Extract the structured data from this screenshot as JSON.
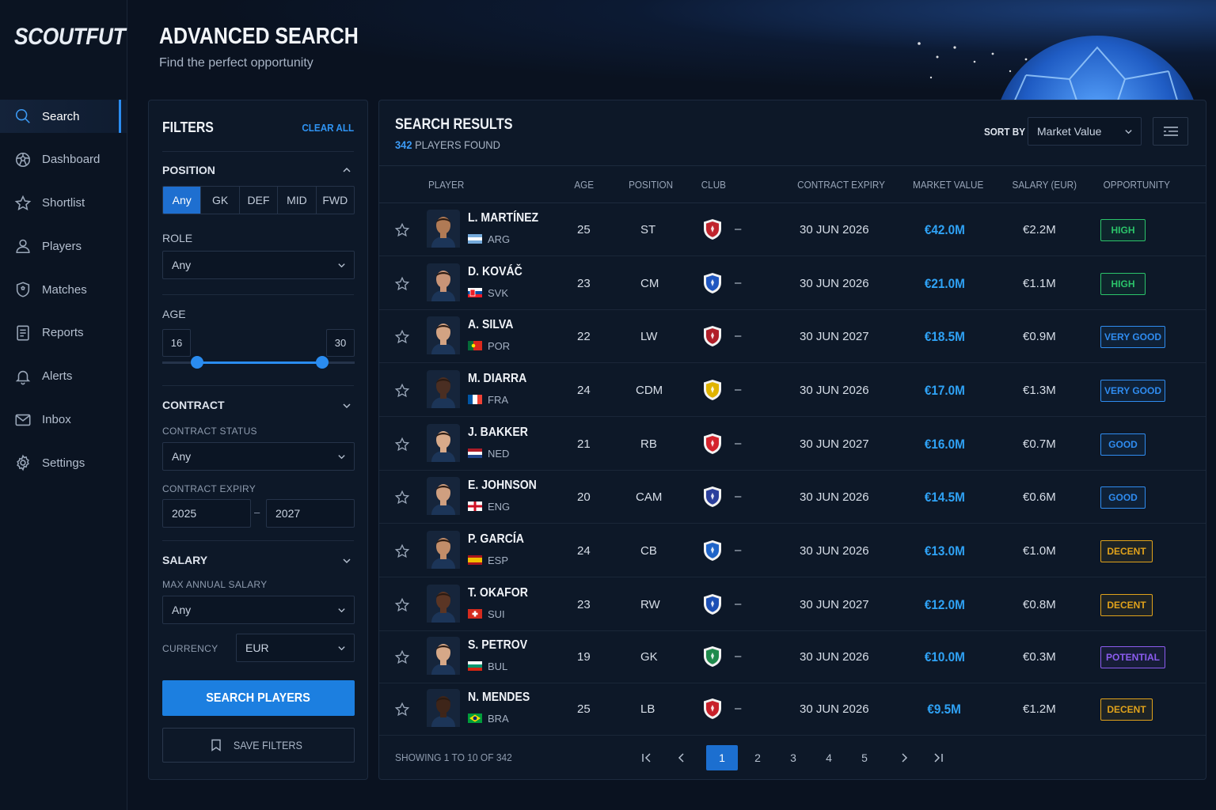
{
  "app": {
    "logo": "SCOUTFUT"
  },
  "sidebar": {
    "items": [
      {
        "label": "Search",
        "icon": "search-icon",
        "active": true
      },
      {
        "label": "Dashboard",
        "icon": "dashboard-icon"
      },
      {
        "label": "Shortlist",
        "icon": "star-icon"
      },
      {
        "label": "Players",
        "icon": "user-icon"
      },
      {
        "label": "Matches",
        "icon": "shield-icon"
      },
      {
        "label": "Reports",
        "icon": "report-icon"
      },
      {
        "label": "Alerts",
        "icon": "bell-icon"
      },
      {
        "label": "Inbox",
        "icon": "mail-icon"
      },
      {
        "label": "Settings",
        "icon": "gear-icon"
      }
    ]
  },
  "header": {
    "title": "ADVANCED SEARCH",
    "subtitle": "Find the perfect opportunity"
  },
  "filters": {
    "title": "FILTERS",
    "clear_all": "CLEAR ALL",
    "position": {
      "title": "POSITION",
      "options": [
        "Any",
        "GK",
        "DEF",
        "MID",
        "FWD"
      ],
      "selected": "Any"
    },
    "role": {
      "title": "ROLE",
      "value": "Any"
    },
    "age": {
      "title": "AGE",
      "min": "16",
      "max": "30",
      "range_min": 16,
      "range_max": 30,
      "fill_from": 0.18,
      "fill_to": 0.83
    },
    "contract": {
      "title": "CONTRACT",
      "status_label": "CONTRACT STATUS",
      "status_value": "Any",
      "expiry_label": "CONTRACT EXPIRY",
      "expiry_from": "2025",
      "expiry_sep": "–",
      "expiry_to": "2027"
    },
    "salary": {
      "title": "SALARY",
      "max_label": "MAX ANNUAL SALARY",
      "max_value": "Any",
      "currency_label": "CURRENCY",
      "currency_value": "EUR"
    },
    "search_button": "SEARCH PLAYERS",
    "save_button": "SAVE FILTERS"
  },
  "results": {
    "title": "SEARCH RESULTS",
    "count": "342",
    "count_suffix": "PLAYERS FOUND",
    "sort_label": "SORT BY",
    "sort_value": "Market Value",
    "columns": [
      "PLAYER",
      "AGE",
      "POSITION",
      "CLUB",
      "CONTRACT EXPIRY",
      "MARKET VALUE",
      "SALARY (EUR)",
      "OPPORTUNITY"
    ],
    "rows": [
      {
        "name": "L. MARTÍNEZ",
        "nat": "ARG",
        "flag": "arg",
        "age": "25",
        "pos": "ST",
        "crest": "#c0242c",
        "club": "–",
        "expiry": "30 JUN 2026",
        "value": "€42.0M",
        "salary": "€2.2M",
        "opp": "HIGH",
        "opp_color": "#2bc46a",
        "skin": "#b07a55"
      },
      {
        "name": "D. KOVÁČ",
        "nat": "SVK",
        "flag": "svk",
        "age": "23",
        "pos": "CM",
        "crest": "#1f56c0",
        "club": "–",
        "expiry": "30 JUN 2026",
        "value": "€21.0M",
        "salary": "€1.1M",
        "opp": "HIGH",
        "opp_color": "#2bc46a",
        "skin": "#c99477"
      },
      {
        "name": "A. SILVA",
        "nat": "POR",
        "flag": "por",
        "age": "22",
        "pos": "LW",
        "crest": "#b01e28",
        "club": "–",
        "expiry": "30 JUN 2027",
        "value": "€18.5M",
        "salary": "€0.9M",
        "opp": "VERY GOOD",
        "opp_color": "#2f8cf0",
        "skin": "#d3a383"
      },
      {
        "name": "M. DIARRA",
        "nat": "FRA",
        "flag": "fra",
        "age": "24",
        "pos": "CDM",
        "crest": "#e0b400",
        "club": "–",
        "expiry": "30 JUN 2026",
        "value": "€17.0M",
        "salary": "€1.3M",
        "opp": "VERY GOOD",
        "opp_color": "#2f8cf0",
        "skin": "#4a2e22"
      },
      {
        "name": "J. BAKKER",
        "nat": "NED",
        "flag": "ned",
        "age": "21",
        "pos": "RB",
        "crest": "#d4232c",
        "club": "–",
        "expiry": "30 JUN 2027",
        "value": "€16.0M",
        "salary": "€0.7M",
        "opp": "GOOD",
        "opp_color": "#2f8cf0",
        "skin": "#d8aa8a"
      },
      {
        "name": "E. JOHNSON",
        "nat": "ENG",
        "flag": "eng",
        "age": "20",
        "pos": "CAM",
        "crest": "#2b3f9c",
        "club": "–",
        "expiry": "30 JUN 2026",
        "value": "€14.5M",
        "salary": "€0.6M",
        "opp": "GOOD",
        "opp_color": "#2f8cf0",
        "skin": "#cf9f80"
      },
      {
        "name": "P. GARCÍA",
        "nat": "ESP",
        "flag": "esp",
        "age": "24",
        "pos": "CB",
        "crest": "#1f64c8",
        "club": "–",
        "expiry": "30 JUN 2026",
        "value": "€13.0M",
        "salary": "€1.0M",
        "opp": "DECENT",
        "opp_color": "#e0a21b",
        "skin": "#c28d69"
      },
      {
        "name": "T. OKAFOR",
        "nat": "SUI",
        "flag": "sui",
        "age": "23",
        "pos": "RW",
        "crest": "#1c4fb4",
        "club": "–",
        "expiry": "30 JUN 2027",
        "value": "€12.0M",
        "salary": "€0.8M",
        "opp": "DECENT",
        "opp_color": "#e0a21b",
        "skin": "#5a3524"
      },
      {
        "name": "S. PETROV",
        "nat": "BUL",
        "flag": "bul",
        "age": "19",
        "pos": "GK",
        "crest": "#1f8a4c",
        "club": "–",
        "expiry": "30 JUN 2026",
        "value": "€10.0M",
        "salary": "€0.3M",
        "opp": "POTENTIAL",
        "opp_color": "#8c5cf0",
        "skin": "#d6a888"
      },
      {
        "name": "N. MENDES",
        "nat": "BRA",
        "flag": "bra",
        "age": "25",
        "pos": "LB",
        "crest": "#c8202a",
        "club": "–",
        "expiry": "30 JUN 2026",
        "value": "€9.5M",
        "salary": "€1.2M",
        "opp": "DECENT",
        "opp_color": "#e0a21b",
        "skin": "#3e2519"
      }
    ],
    "footer": "SHOWING 1 TO 10 OF 342",
    "pages": [
      "1",
      "2",
      "3",
      "4",
      "5"
    ],
    "current_page": "1"
  }
}
